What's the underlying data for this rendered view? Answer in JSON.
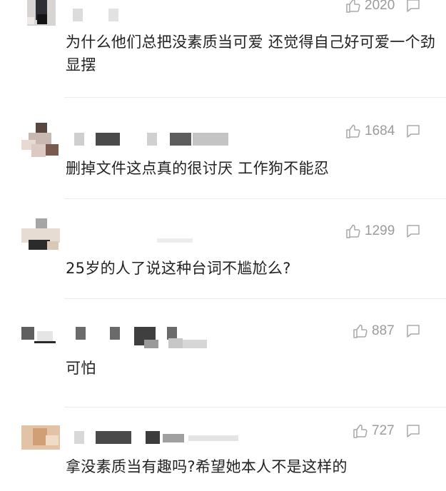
{
  "comments": [
    {
      "text": "为什么他们总把没素质当可爱 还觉得自己好可爱一个劲显摆",
      "likes": "2020",
      "like_icon": "thumbs-up-icon",
      "reply_icon": "comment-icon"
    },
    {
      "text": "删掉文件这点真的很讨厌 工作狗不能忍",
      "likes": "1684",
      "like_icon": "thumbs-up-icon",
      "reply_icon": "comment-icon"
    },
    {
      "text": "25岁的人了说这种台词不尴尬么?",
      "likes": "1299",
      "like_icon": "thumbs-up-icon",
      "reply_icon": "comment-icon"
    },
    {
      "text": "可怕",
      "likes": "887",
      "like_icon": "thumbs-up-icon",
      "reply_icon": "comment-icon"
    },
    {
      "text": "拿没素质当有趣吗?希望她本人不是这样的",
      "likes": "727",
      "like_icon": "thumbs-up-icon",
      "reply_icon": "comment-icon"
    }
  ],
  "colors": {
    "meta_text": "#9b9b9b",
    "body_text": "#222222",
    "divider": "#ececec"
  }
}
